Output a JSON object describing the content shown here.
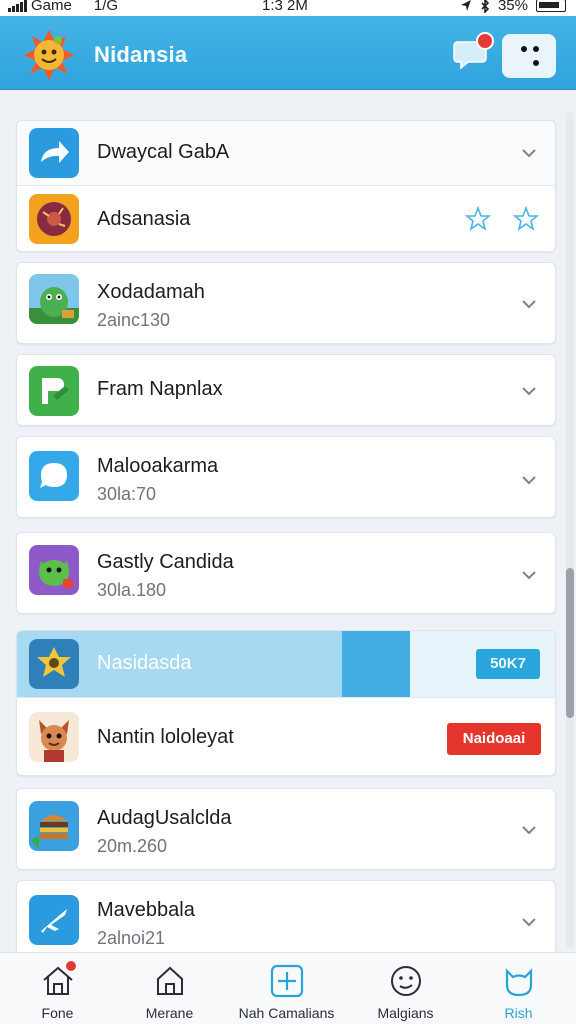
{
  "status": {
    "carrier": "Game",
    "network": "1/G",
    "time": "1:3 2M",
    "battery": "35%"
  },
  "header": {
    "title": "Nidansia",
    "colors": {
      "bar": "#35a8df",
      "badge": "#e53935"
    }
  },
  "list": {
    "groups": [
      {
        "rows": [
          {
            "label": "Dwaycal GabA",
            "icon": "share-arrow-icon",
            "trailing": "chevron"
          },
          {
            "label": "Adsanasia",
            "icon": "donut-game-icon",
            "trailing": "stars"
          }
        ]
      },
      {
        "rows": [
          {
            "label": "Xodadamah",
            "sub": "2ainc130",
            "icon": "monster-game-icon",
            "trailing": "chevron"
          }
        ]
      },
      {
        "rows": [
          {
            "label": "Fram Napnlax",
            "icon": "pen-app-icon",
            "trailing": "chevron"
          }
        ]
      },
      {
        "rows": [
          {
            "label": "Malooakarma",
            "sub": "30la:70",
            "icon": "chat-bubble-icon",
            "trailing": "chevron"
          }
        ]
      },
      {
        "rows": [
          {
            "label": "Gastly Candida",
            "sub": "30la.180",
            "icon": "dragon-game-icon",
            "trailing": "chevron"
          }
        ]
      },
      {
        "rows": [
          {
            "label": "Nasidasda",
            "icon": "robot-game-icon",
            "trailing": "tag",
            "tag": "50K7",
            "highlight": true
          },
          {
            "label": "Nantin lololeyat",
            "icon": "fox-character-icon",
            "trailing": "tag",
            "tag": "Naidoaai"
          }
        ]
      },
      {
        "rows": [
          {
            "label": "AudagUsalclda",
            "sub": "20m.260",
            "icon": "burger-game-icon",
            "trailing": "chevron"
          }
        ]
      },
      {
        "rows": [
          {
            "label": "Mavebbala",
            "sub": "2alnoi21",
            "icon": "plane-app-icon",
            "trailing": "chevron"
          }
        ]
      }
    ]
  },
  "bottom_nav": {
    "items": [
      {
        "label": "Fone",
        "icon": "home-icon",
        "badge": true
      },
      {
        "label": "Merane",
        "icon": "house-outline-icon"
      },
      {
        "label": "Nah Camalians",
        "icon": "tablet-plus-icon"
      },
      {
        "label": "Malgians",
        "icon": "face-icon"
      },
      {
        "label": "Rish",
        "icon": "cat-icon",
        "active": true
      }
    ]
  }
}
